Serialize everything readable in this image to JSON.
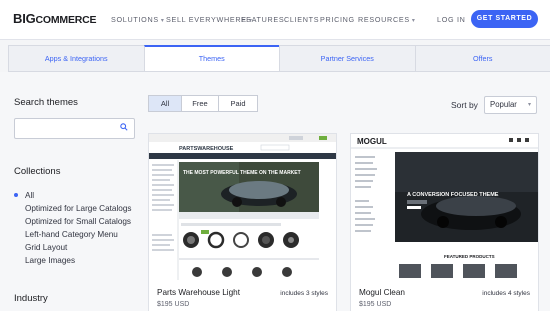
{
  "header": {
    "logo_prefix": "BIG",
    "logo_suffix": "COMMERCE",
    "nav": [
      "SOLUTIONS",
      "SELL EVERYWHERE",
      "FEATURES",
      "CLIENTS",
      "PRICING",
      "RESOURCES"
    ],
    "login": "LOG IN",
    "cta": "GET STARTED"
  },
  "tabs": [
    "Apps & Integrations",
    "Themes",
    "Partner Services",
    "Offers"
  ],
  "active_tab": "Themes",
  "sidebar": {
    "search_heading": "Search themes",
    "search_placeholder": "",
    "collections_heading": "Collections",
    "collections": [
      {
        "label": "All",
        "selected": true
      },
      {
        "label": "Optimized for Large Catalogs",
        "selected": false
      },
      {
        "label": "Optimized for Small Catalogs",
        "selected": false
      },
      {
        "label": "Left-hand Category Menu",
        "selected": false
      },
      {
        "label": "Grid Layout",
        "selected": false
      },
      {
        "label": "Large Images",
        "selected": false
      }
    ],
    "industry_heading": "Industry"
  },
  "filters": {
    "options": [
      "All",
      "Free",
      "Paid"
    ],
    "active": "All"
  },
  "sort": {
    "label": "Sort by",
    "value": "Popular"
  },
  "themes": [
    {
      "name": "Parts Warehouse Light",
      "styles": "includes 3 styles",
      "price": "$195 USD",
      "preview": {
        "logo": "PARTSWAREHOUSE",
        "headline": "THE MOST POWERFUL THEME ON THE MARKET"
      }
    },
    {
      "name": "Mogul Clean",
      "styles": "includes 4 styles",
      "price": "$195 USD",
      "preview": {
        "logo": "MOGUL",
        "headline": "A CONVERSION FOCUSED THEME",
        "section": "FEATURED PRODUCTS"
      }
    }
  ],
  "colors": {
    "accent": "#3c64f4",
    "text": "#313440",
    "tab_bg": "#eef0f4",
    "page_bg": "#f6f7f9"
  },
  "icons": {
    "search": "search-icon",
    "dropdown": "chevron-down-icon",
    "radio": "radio-dot-icon"
  }
}
